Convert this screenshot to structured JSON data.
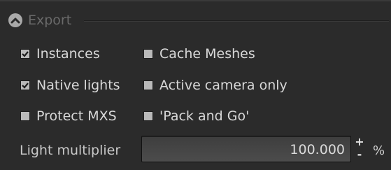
{
  "section": {
    "title": "Export"
  },
  "options": [
    {
      "label": "Instances",
      "checked": true
    },
    {
      "label": "Cache Meshes",
      "checked": false
    },
    {
      "label": "Native lights",
      "checked": true
    },
    {
      "label": "Active camera only",
      "checked": false
    },
    {
      "label": "Protect MXS",
      "checked": false
    },
    {
      "label": "'Pack and Go'",
      "checked": false
    }
  ],
  "light_multiplier": {
    "label": "Light multiplier",
    "value": "100.000",
    "spin_up": "+",
    "spin_down": "-",
    "unit": "%"
  },
  "icons": {
    "collapse": "chevron-up-circle-icon",
    "checkmark": "checkmark-icon"
  },
  "colors": {
    "panel_bg": "#2b2b2b",
    "checkbox_fill": "#b9b9b9",
    "text": "#d8d8d8",
    "header_text": "#6a6a6a"
  }
}
